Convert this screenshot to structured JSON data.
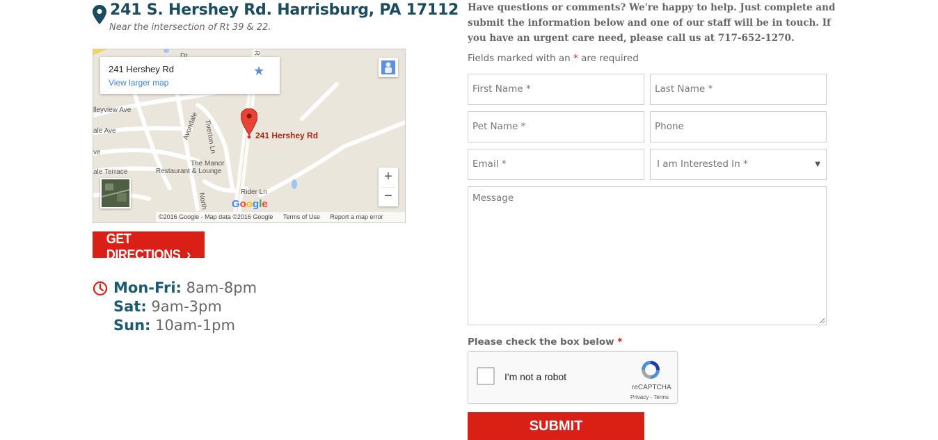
{
  "location": {
    "address": "241 S. Hershey Rd. Harrisburg, PA 17112",
    "near": "Near the intersection of Rt 39 & 22."
  },
  "map": {
    "card_title": "241 Hershey Rd",
    "card_link": "View larger map",
    "pin_label": "241 Hershey Rd",
    "places": {
      "valleyview": "lleyview Ave",
      "ale_ave": "ale Ave",
      "ve": "ve",
      "terrace": "ale Terrace",
      "avondale": "Avondale",
      "tiverton": "Tiverton Ln",
      "manor_1": "The Manor",
      "manor_2": "Restaurant & Lounge",
      "rider": "Rider Ln",
      "north": "North",
      "dr": "Dr",
      "road_r": "R"
    },
    "google": "Google",
    "footer": {
      "copyright": "©2016 Google - Map data ©2016 Google",
      "terms": "Terms of Use",
      "report": "Report a map error"
    },
    "zoom_in": "+",
    "zoom_out": "−"
  },
  "directions_button": "GET DIRECTIONS",
  "hours": [
    {
      "day": "Mon-Fri:",
      "time": "8am-8pm"
    },
    {
      "day": "Sat:",
      "time": "9am-3pm"
    },
    {
      "day": "Sun:",
      "time": "10am-1pm"
    }
  ],
  "form": {
    "intro": "Have questions or comments? We're happy to help. Just complete and submit the information below and one of our staff will be in touch. If you have an urgent care need, please call us at 717-652-1270.",
    "required_note_pre": "Fields marked with an",
    "required_star": "*",
    "required_note_post": "are required",
    "placeholders": {
      "first_name": "First Name *",
      "last_name": "Last Name *",
      "pet_name": "Pet Name *",
      "phone": "Phone",
      "email": "Email *",
      "interested": "I am Interested In *",
      "message": "Message"
    },
    "check_label": "Please check the box below",
    "recaptcha": {
      "label": "I'm not a robot",
      "brand": "reCAPTCHA",
      "links": "Privacy - Terms"
    },
    "submit": "SUBMIT"
  },
  "colors": {
    "brand_red": "#d91f16",
    "heading_teal": "#1a4b5f"
  }
}
